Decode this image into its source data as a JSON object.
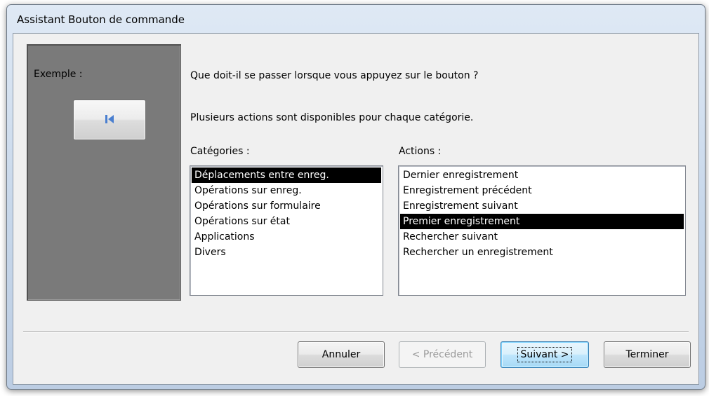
{
  "window": {
    "title": "Assistant Bouton de commande"
  },
  "example": {
    "label": "Exemple :",
    "button_icon": "first-record-icon"
  },
  "question": "Que doit-il se passer lorsque vous appuyez sur le bouton ?",
  "hint": "Plusieurs actions sont disponibles pour chaque catégorie.",
  "categories": {
    "label": "Catégories :",
    "items": [
      "Déplacements entre enreg.",
      "Opérations sur enreg.",
      "Opérations sur formulaire",
      "Opérations sur état",
      "Applications",
      "Divers"
    ],
    "selected_index": 0
  },
  "actions": {
    "label": "Actions :",
    "items": [
      "Dernier enregistrement",
      "Enregistrement précédent",
      "Enregistrement suivant",
      "Premier enregistrement",
      "Rechercher suivant",
      "Rechercher un enregistrement"
    ],
    "selected_index": 3
  },
  "buttons": {
    "cancel": "Annuler",
    "previous": "< Précédent",
    "next": "Suivant >",
    "finish": "Terminer"
  },
  "colors": {
    "selection": "#000000",
    "example_panel": "#7a7a7a",
    "icon": "#4a7fd0"
  }
}
